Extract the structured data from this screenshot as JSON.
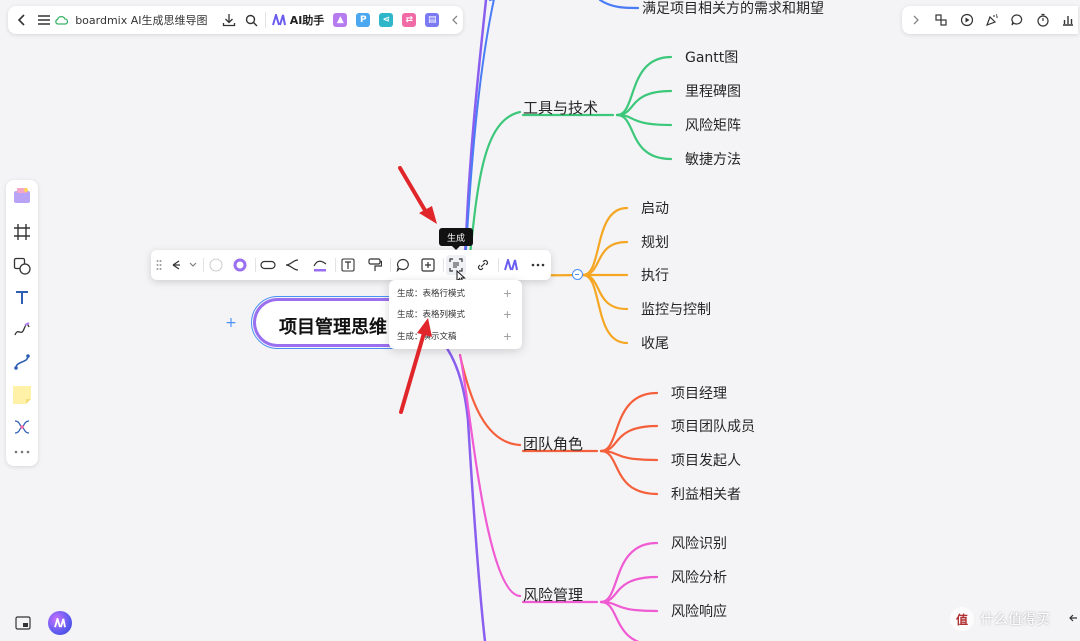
{
  "topbar": {
    "title": "boardmix AI生成思维导图",
    "ai_label": "AI助手",
    "plugins": [
      {
        "icon": "image-plugin-icon",
        "color": "#b57cf0",
        "glyph": "▲"
      },
      {
        "icon": "p-plugin-icon",
        "color": "#4aa7f0",
        "glyph": "P"
      },
      {
        "icon": "share-plugin-icon",
        "color": "#2fb6c9",
        "glyph": "⋖"
      },
      {
        "icon": "flow-plugin-icon",
        "color": "#f06aa5",
        "glyph": "⇄"
      },
      {
        "icon": "chat-plugin-icon",
        "color": "#7a7af5",
        "glyph": "▤"
      }
    ]
  },
  "tooltip": "生成",
  "menu": {
    "items": [
      {
        "label": "生成：表格行模式",
        "plus": "+"
      },
      {
        "label": "生成：表格列模式",
        "plus": "+"
      },
      {
        "label": "生成：演示文稿",
        "plus": "+"
      }
    ]
  },
  "root_node": {
    "text": "项目管理思维",
    "plus": "+"
  },
  "mindmap": {
    "top_leaf": {
      "text": "满足项目相关方的需求和期望",
      "color": "#4a7cf5"
    },
    "branches": [
      {
        "id": "tools",
        "label": "工具与技术",
        "color": "#3cc77a",
        "leaves": [
          "Gantt图",
          "里程碑图",
          "风险矩阵",
          "敏捷方法"
        ]
      },
      {
        "id": "process",
        "label": "",
        "color": "#f5a623",
        "leaves": [
          "启动",
          "规划",
          "执行",
          "监控与控制",
          "收尾"
        ]
      },
      {
        "id": "roles",
        "label": "团队角色",
        "color": "#f5603c",
        "leaves": [
          "项目经理",
          "项目团队成员",
          "项目发起人",
          "利益相关者"
        ]
      },
      {
        "id": "risk",
        "label": "风险管理",
        "color": "#f05ad2",
        "leaves": [
          "风险识别",
          "风险分析",
          "风险响应"
        ]
      }
    ]
  },
  "watermark": {
    "text": "什么值得买",
    "logo": "值"
  },
  "colors": {
    "accent": "#9a70f0",
    "selection": "#4a90f5",
    "arrow": "#e0262a"
  }
}
